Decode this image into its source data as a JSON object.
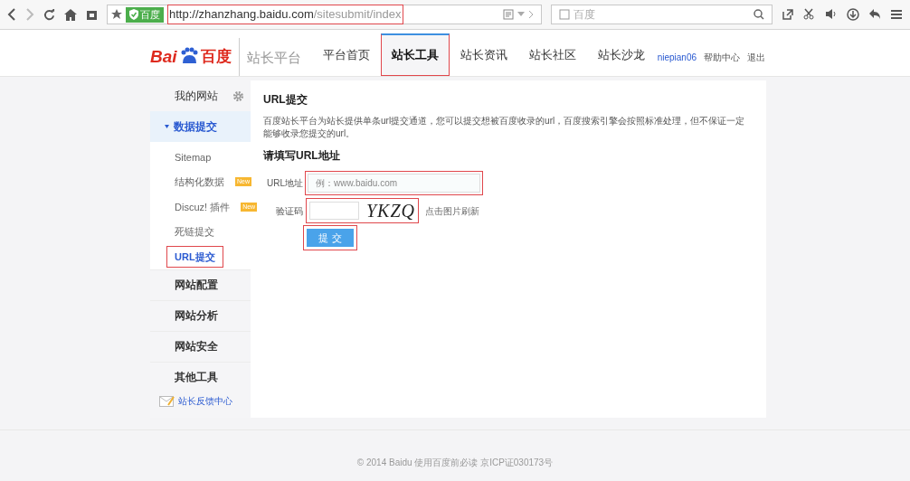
{
  "browser": {
    "site_badge": "百度",
    "url_host": "http://zhanzhang.baidu.com",
    "url_path": "/sitesubmit/index",
    "url_highlighted": true,
    "search_placeholder": "百度"
  },
  "header": {
    "logo_wordmark": "Bai",
    "logo_brand": "百度",
    "logo_product": "站长平台",
    "nav": [
      {
        "label": "平台首页",
        "selected": false,
        "highlighted": false
      },
      {
        "label": "站长工具",
        "selected": true,
        "highlighted": true
      },
      {
        "label": "站长资讯",
        "selected": false,
        "highlighted": false
      },
      {
        "label": "站长社区",
        "selected": false,
        "highlighted": false
      },
      {
        "label": "站长沙龙",
        "selected": false,
        "highlighted": false
      }
    ],
    "user": "niepian06",
    "links": [
      "帮助中心",
      "退出"
    ]
  },
  "sidebar": {
    "title": "我的网站",
    "items": [
      {
        "label": "数据提交",
        "expanded": true,
        "children": [
          {
            "label": "Sitemap",
            "selected": false,
            "highlighted": false
          },
          {
            "label": "结构化数据",
            "badge": "New",
            "selected": false,
            "highlighted": false
          },
          {
            "label": "Discuz! 插件",
            "badge": "New",
            "selected": false,
            "highlighted": false
          },
          {
            "label": "死链提交",
            "selected": false,
            "highlighted": false
          },
          {
            "label": "URL提交",
            "selected": true,
            "highlighted": true
          }
        ]
      },
      {
        "label": "网站配置",
        "expanded": false
      },
      {
        "label": "网站分析",
        "expanded": false
      },
      {
        "label": "网站安全",
        "expanded": false
      },
      {
        "label": "其他工具",
        "expanded": false
      }
    ],
    "feedback": "站长反馈中心"
  },
  "content": {
    "title": "URL提交",
    "description": "百度站长平台为站长提供单条url提交通道，您可以提交想被百度收录的url，百度搜索引擎会按照标准处理，但不保证一定能够收录您提交的url。",
    "form_title": "请填写URL地址",
    "url_field": {
      "label": "URL地址",
      "placeholder": "例：www.baidu.com",
      "highlighted": true
    },
    "captcha_field": {
      "label": "验证码",
      "captcha": "YKZQ",
      "refresh": "点击图片刷新",
      "highlighted": true
    },
    "submit": {
      "label": "提 交",
      "highlighted": true
    }
  },
  "footer": "© 2014 Baidu 使用百度前必读 京ICP证030173号"
}
